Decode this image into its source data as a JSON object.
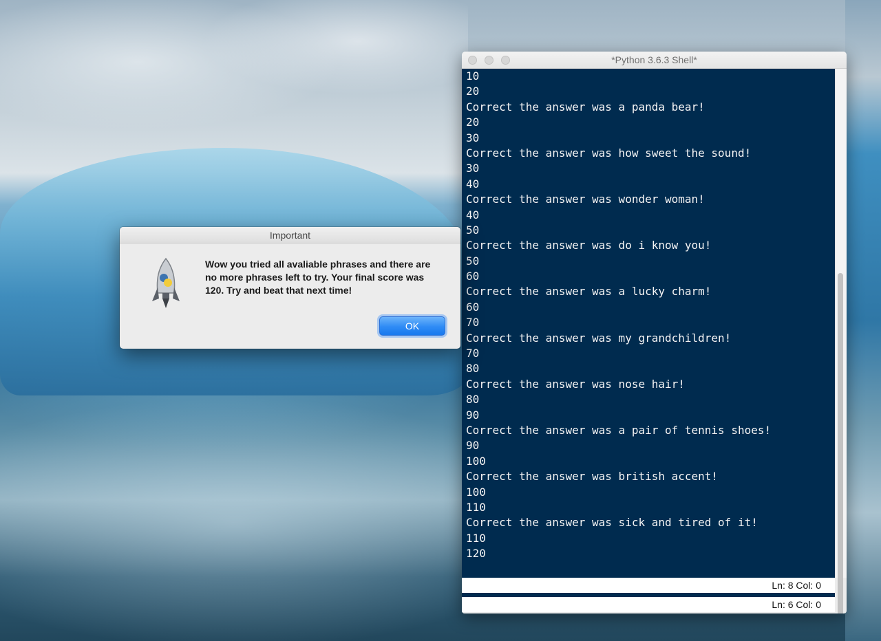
{
  "shell": {
    "title": "*Python 3.6.3 Shell*",
    "lines": [
      "10",
      "20",
      "Correct the answer was a panda bear!",
      "20",
      "30",
      "Correct the answer was how sweet the sound!",
      "30",
      "40",
      "Correct the answer was wonder woman!",
      "40",
      "50",
      "Correct the answer was do i know you!",
      "50",
      "60",
      "Correct the answer was a lucky charm!",
      "60",
      "70",
      "Correct the answer was my grandchildren!",
      "70",
      "80",
      "Correct the answer was nose hair!",
      "80",
      "90",
      "Correct the answer was a pair of tennis shoes!",
      "90",
      "100",
      "Correct the answer was british accent!",
      "100",
      "110",
      "Correct the answer was sick and tired of it!",
      "110",
      "120"
    ],
    "status_top": "Ln: 8   Col: 0",
    "status_bottom": "Ln: 6   Col: 0",
    "background_color": "#002b4f"
  },
  "dialog": {
    "title": "Important",
    "message": "Wow you tried all avaliable phrases and there are no more phrases left to try. Your final score was 120. Try and beat that next time!",
    "ok_label": "OK",
    "icon": "python-launcher-rocket-icon"
  }
}
